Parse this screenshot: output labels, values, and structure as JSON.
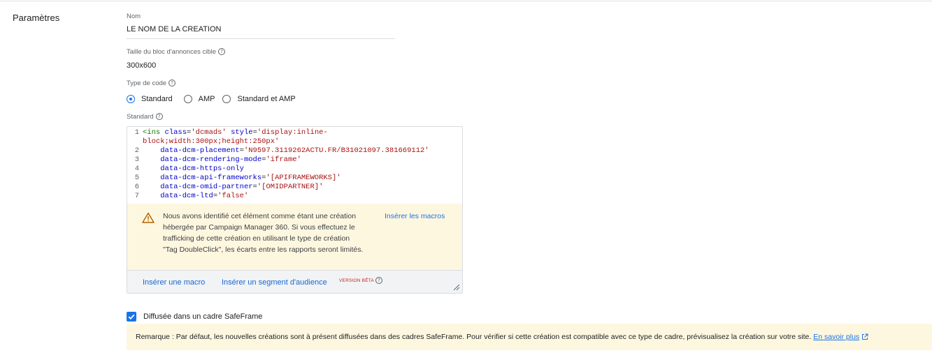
{
  "section": {
    "title": "Paramètres"
  },
  "name_field": {
    "label": "Nom",
    "value": "LE NOM DE LA CREATION"
  },
  "size_field": {
    "label": "Taille du bloc d'annonces cible",
    "value": "300x600"
  },
  "code_type": {
    "label": "Type de code",
    "options": [
      {
        "label": "Standard",
        "selected": true
      },
      {
        "label": "AMP",
        "selected": false
      },
      {
        "label": "Standard et AMP",
        "selected": false
      }
    ]
  },
  "standard": {
    "label": "Standard",
    "code_lines": [
      {
        "num": "1",
        "text": "<ins class='dcmads' style='display:inline-block;width:300px;height:250px'"
      },
      {
        "num": "2",
        "text": "    data-dcm-placement='N9597.3119262ACTU.FR/B31021097.381669112'"
      },
      {
        "num": "3",
        "text": "    data-dcm-rendering-mode='iframe'"
      },
      {
        "num": "4",
        "text": "    data-dcm-https-only"
      },
      {
        "num": "5",
        "text": "    data-dcm-api-frameworks='[APIFRAMEWORKS]'"
      },
      {
        "num": "6",
        "text": "    data-dcm-omid-partner='[OMIDPARTNER]'"
      },
      {
        "num": "7",
        "text": "    data-dcm-ltd='false'"
      }
    ]
  },
  "warning": {
    "icon": "warning-icon",
    "text": "Nous avons identifié cet élément comme étant une création hébergée par Campaign Manager 360. Si vous effectuez le trafficking de cette création en utilisant le type de création \"Tag DoubleClick\", les écarts entre les rapports seront limités.",
    "link": "Insérer les macros"
  },
  "footer": {
    "insert_macro": "Insérer une macro",
    "insert_segment": "Insérer un segment d'audience",
    "beta": "VERSION BÊTA"
  },
  "safeframe": {
    "checked": true,
    "label": "Diffusée dans un cadre SafeFrame"
  },
  "note": {
    "text": "Remarque : Par défaut, les nouvelles créations sont à présent diffusées dans des cadres SafeFrame. Pour vérifier si cette création est compatible avec ce type de cadre, prévisualisez la création sur votre site.",
    "link": "En savoir plus"
  },
  "colors": {
    "accent": "#1a73e8",
    "warning_bg": "#fef7e0",
    "beta": "#c5221f"
  }
}
